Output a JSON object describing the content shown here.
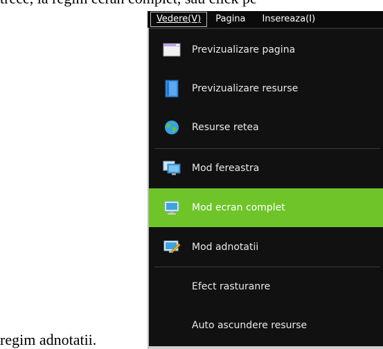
{
  "document": {
    "top_text": "trece, la regim ecran complet, sau click pe",
    "bottom_text": "regim adnotatii."
  },
  "menubar": {
    "items": [
      {
        "label": "Vedere(V)"
      },
      {
        "label": "Pagina"
      },
      {
        "label": "Insereaza(I)"
      }
    ]
  },
  "menu": {
    "items": [
      {
        "label": "Previzualizare pagina",
        "icon": "page-preview-icon"
      },
      {
        "label": "Previzualizare resurse",
        "icon": "resource-preview-icon"
      },
      {
        "label": "Resurse retea",
        "icon": "globe-icon"
      },
      {
        "label": "Mod fereastra",
        "icon": "window-monitor-icon"
      },
      {
        "label": "Mod ecran complet",
        "icon": "fullscreen-monitor-icon"
      },
      {
        "label": "Mod adnotatii",
        "icon": "annotation-monitor-icon"
      },
      {
        "label": "Efect rasturanre"
      },
      {
        "label": "Auto ascundere resurse"
      }
    ]
  },
  "colors": {
    "menu_bg": "#111111",
    "highlight": "#6ec429",
    "menubar_bg": "#0b0b0b"
  }
}
